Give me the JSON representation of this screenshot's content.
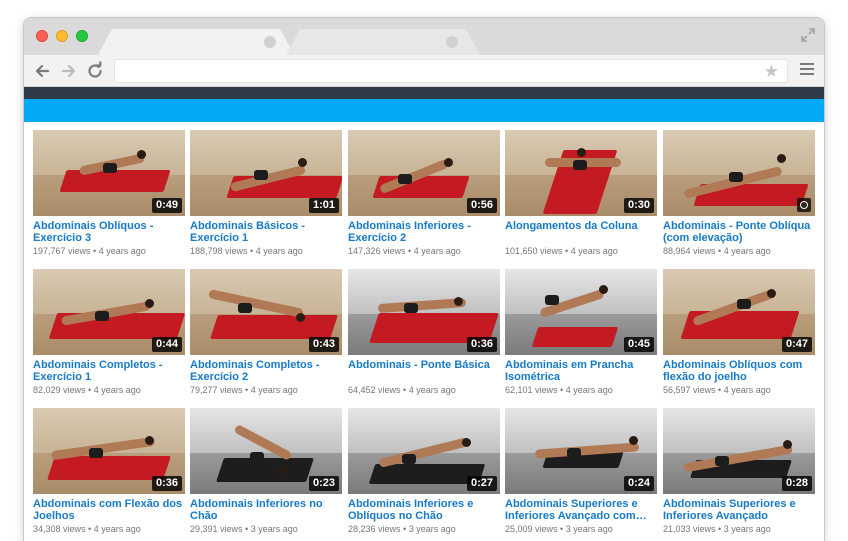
{
  "colors": {
    "banner_dark": "#2f3c48",
    "banner_blue": "#03a9f4",
    "link": "#167ac6",
    "meta": "#767676"
  },
  "browser": {
    "icons": [
      "back-arrow-icon",
      "forward-arrow-icon",
      "reload-icon",
      "star-icon",
      "hamburger-menu-icon",
      "expand-icon"
    ],
    "star_glyph": "★"
  },
  "videos": [
    {
      "title": "Abdominais Oblíquos - Exercício 3",
      "views": "197,767 views",
      "age": "4 years ago",
      "duration": "0:49"
    },
    {
      "title": "Abdominais Básicos - Exercício 1",
      "views": "188,798 views",
      "age": "4 years ago",
      "duration": "1:01"
    },
    {
      "title": "Abdominais Inferiores - Exercício 2",
      "views": "147,326 views",
      "age": "4 years ago",
      "duration": "0:56"
    },
    {
      "title": "Alongamentos da Coluna",
      "views": "101,650 views",
      "age": "4 years ago",
      "duration": "0:30"
    },
    {
      "title": "Abdominais - Ponte Oblíqua (com elevação)",
      "views": "88,964 views",
      "age": "4 years ago",
      "duration": ""
    },
    {
      "title": "Abdominais Completos - Exercício 1",
      "views": "82,029 views",
      "age": "4 years ago",
      "duration": "0:44"
    },
    {
      "title": "Abdominais Completos - Exercício 2",
      "views": "79,277 views",
      "age": "4 years ago",
      "duration": "0:43"
    },
    {
      "title": "Abdominais - Ponte Básica",
      "views": "64,452 views",
      "age": "4 years ago",
      "duration": "0:36"
    },
    {
      "title": "Abdominais em Prancha Isométrica",
      "views": "62,101 views",
      "age": "4 years ago",
      "duration": "0:45"
    },
    {
      "title": "Abdominais Oblíquos com flexão do joelho",
      "views": "56,597 views",
      "age": "4 years ago",
      "duration": "0:47"
    },
    {
      "title": "Abdominais com Flexão dos Joelhos",
      "views": "34,308 views",
      "age": "4 years ago",
      "duration": "0:36"
    },
    {
      "title": "Abdominais Inferiores no Chão",
      "views": "29,391 views",
      "age": "3 years ago",
      "duration": "0:23"
    },
    {
      "title": "Abdominais Inferiores e Oblíquos no Chão",
      "views": "28,236 views",
      "age": "3 years ago",
      "duration": "0:27"
    },
    {
      "title": "Abdominais Superiores e Inferiores Avançado com…",
      "views": "25,009 views",
      "age": "3 years ago",
      "duration": "0:24"
    },
    {
      "title": "Abdominais Superiores e Inferiores Avançado",
      "views": "21,033 views",
      "age": "3 years ago",
      "duration": "0:28"
    }
  ]
}
